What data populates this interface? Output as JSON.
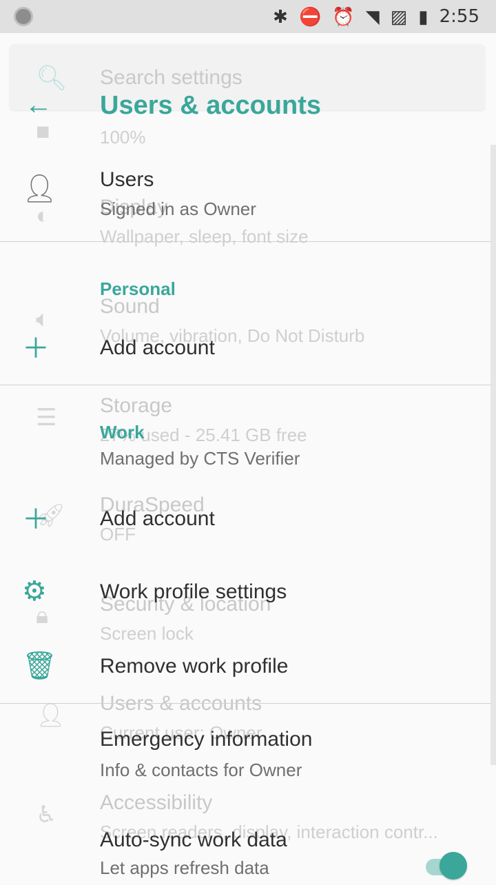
{
  "status": {
    "time": "2:55",
    "icons": [
      "bluetooth-icon",
      "dnd-icon",
      "alarm-icon",
      "wifi-icon",
      "no-sim-icon",
      "battery-charging-icon"
    ]
  },
  "ghost": {
    "search_placeholder": "Search settings",
    "items": [
      {
        "title": "",
        "sub": "100%"
      },
      {
        "title": "Display",
        "sub": "Wallpaper, sleep, font size"
      },
      {
        "title": "Sound",
        "sub": "Volume, vibration, Do Not Disturb"
      },
      {
        "title": "Storage",
        "sub": "27% used - 25.41 GB free"
      },
      {
        "title": "DuraSpeed",
        "sub": "OFF"
      },
      {
        "title": "Security & location",
        "sub": "Screen lock"
      },
      {
        "title": "Users & accounts",
        "sub": "Current user: Owner"
      },
      {
        "title": "Accessibility",
        "sub": "Screen readers, display, interaction contr..."
      }
    ]
  },
  "appbar": {
    "title": "Users & accounts"
  },
  "list": {
    "users_title": "Users",
    "users_sub": "Signed in as Owner",
    "personal_header": "Personal",
    "personal_add": "Add account",
    "work_header": "Work",
    "work_sub": "Managed by CTS Verifier",
    "work_add": "Add account",
    "work_settings": "Work profile settings",
    "remove_work": "Remove work profile",
    "emergency_title": "Emergency information",
    "emergency_sub": "Info & contacts for Owner",
    "autosync_title": "Auto-sync work data",
    "autosync_sub": "Let apps refresh data"
  },
  "colors": {
    "accent": "#3aa79a"
  }
}
